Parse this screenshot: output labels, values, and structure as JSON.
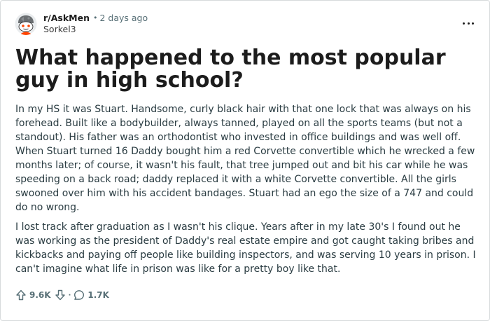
{
  "post": {
    "subreddit": "r/AskMen",
    "separator": "•",
    "time_ago": "2 days ago",
    "author": "Sorkel3",
    "title": "What happened to the most popular guy in high school?",
    "paragraphs": [
      "In my HS it was Stuart. Handsome, curly black hair with that one lock that was always on his forehead. Built like a bodybuilder, always tanned, played on all the sports teams (but not a standout). His father was an orthodontist who invested in office buildings and was well off. When Stuart turned 16 Daddy bought him a red Corvette convertible which he wrecked a few months later; of course, it wasn't his fault, that tree jumped out and bit his car while he was speeding on a back road; daddy replaced it with a white Corvette convertible. All the girls swooned over him with his accident bandages. Stuart had an ego the size of a 747 and could do no wrong.",
      "I lost track after graduation as I wasn't his clique. Years after in my late 30's I found out he was working as the president of Daddy's real estate empire and got caught taking bribes and kickbacks and paying off people like building inspectors, and was serving 10 years in prison. I can't imagine what life in prison was like for a pretty boy like that."
    ],
    "upvotes": "9.6K",
    "action_separator": "·",
    "comments": "1.7K"
  },
  "icons": {
    "avatar": "snoo-avatar-icon",
    "more": "more-options-icon",
    "upvote": "upvote-arrow-icon",
    "downvote": "downvote-arrow-icon",
    "comment": "comment-bubble-icon"
  },
  "colors": {
    "text_primary": "#1c1c1c",
    "text_body": "#2a3c42",
    "text_muted": "#576f76",
    "avatar_accent": "#ff4500",
    "border": "#d7dadc"
  }
}
